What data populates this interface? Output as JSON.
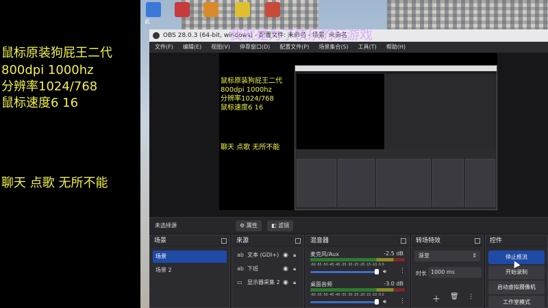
{
  "overlay": {
    "lines": [
      "鼠标原装狗屁王二代",
      "800dpi 1000hz",
      "分辨率1024/768",
      "鼠标速度6   16"
    ],
    "chat_line": "聊天 点歌 无所不能"
  },
  "watermark": "我就是为了快乐的玩游戏",
  "desktop": {
    "icon_label": "此"
  },
  "obs": {
    "title": "OBS 28.0.3 (64-bit, windows) - 配置文件: 未命名 - 场景: 未命名",
    "menu": [
      "文件(F)",
      "编辑(E)",
      "视图(V)",
      "停靠窗口(D)",
      "配置文件(P)",
      "场景集合(S)",
      "工具(T)",
      "帮助(H)"
    ],
    "preview_text": {
      "lines": [
        "鼠标原装狗屁王二代",
        "800dpi 1000hz",
        "分辨率1024/768",
        "鼠标速度6   16"
      ],
      "chat_line": "聊天 点歌 无所不能"
    },
    "context_bar": {
      "no_source": "未选择源",
      "properties": "属性",
      "filters": "滤镜"
    },
    "scenes": {
      "title": "场景",
      "items": [
        "场景",
        "场景 2"
      ]
    },
    "sources": {
      "title": "来源",
      "items": [
        "文本 (GDI+)",
        "下班",
        "显示器采集 2"
      ]
    },
    "mixer": {
      "title": "混音器",
      "channels": [
        {
          "name": "麦克风/Aux",
          "db": "-2.5 dB"
        },
        {
          "name": "桌面音频",
          "db": "-3.0 dB"
        }
      ],
      "ticks": "-60 -55 -50 -45 -40 -35 -30 -25 -20 -15 -10 -5 0"
    },
    "transitions": {
      "title": "转场特效",
      "selected": "渐变",
      "duration_label": "时长",
      "duration_value": "1000 ms"
    },
    "controls": {
      "title": "控件",
      "buttons": [
        "停止推流",
        "开始录制",
        "启动虚拟摄像机",
        "工作室模式"
      ]
    }
  }
}
